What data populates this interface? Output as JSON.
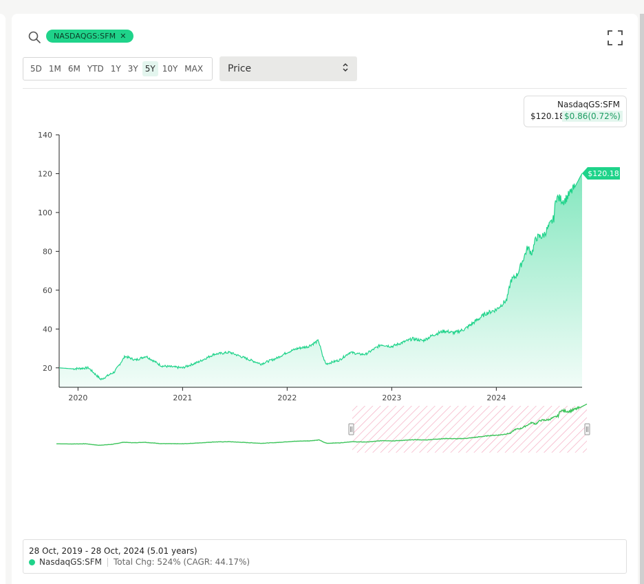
{
  "search": {
    "ticker_chip": "NASDAQGS:SFM",
    "remove_icon": "close-icon"
  },
  "icons": {
    "search": "search-icon",
    "fullscreen": "fullscreen-icon",
    "select": "chevron-updown-icon"
  },
  "ranges": [
    {
      "label": "5D",
      "active": false
    },
    {
      "label": "1M",
      "active": false
    },
    {
      "label": "6M",
      "active": false
    },
    {
      "label": "YTD",
      "active": false
    },
    {
      "label": "1Y",
      "active": false
    },
    {
      "label": "3Y",
      "active": false
    },
    {
      "label": "5Y",
      "active": true
    },
    {
      "label": "10Y",
      "active": false
    },
    {
      "label": "MAX",
      "active": false
    }
  ],
  "metric_select": {
    "value": "Price"
  },
  "legend": {
    "name": "NasdaqGS:SFM",
    "price": "$120.18",
    "change": "$0.86(0.72%)"
  },
  "colors": {
    "accent": "#1fd38a",
    "line": "#1fd38a",
    "navigator_line": "#3cc45a",
    "selection_hatch": "#f4a6bd"
  },
  "chart_data": {
    "type": "area",
    "series_name": "NasdaqGS:SFM",
    "ylim": [
      10,
      140
    ],
    "y_ticks": [
      20,
      40,
      60,
      80,
      100,
      120,
      140
    ],
    "x_range": [
      "2019-10-28",
      "2024-10-28"
    ],
    "x_tick_labels": [
      "2020",
      "2021",
      "2022",
      "2023",
      "2024"
    ],
    "last_value_label": "$120.18",
    "x": [
      2019.82,
      2019.95,
      2020.1,
      2020.22,
      2020.35,
      2020.45,
      2020.55,
      2020.65,
      2020.8,
      2021.0,
      2021.15,
      2021.3,
      2021.45,
      2021.6,
      2021.75,
      2021.9,
      2022.0,
      2022.1,
      2022.2,
      2022.3,
      2022.34,
      2022.37,
      2022.5,
      2022.6,
      2022.7,
      2022.75,
      2022.9,
      2023.0,
      2023.1,
      2023.2,
      2023.3,
      2023.4,
      2023.5,
      2023.6,
      2023.7,
      2023.8,
      2023.9,
      2024.0,
      2024.1,
      2024.14,
      2024.2,
      2024.3,
      2024.34,
      2024.38,
      2024.45,
      2024.55,
      2024.57,
      2024.65,
      2024.75,
      2024.82
    ],
    "y": [
      20,
      19.5,
      20,
      14,
      18,
      26,
      24,
      26,
      21,
      20,
      23,
      27,
      28,
      25,
      22,
      25,
      28,
      30,
      31,
      34,
      26,
      22,
      24,
      28,
      27,
      27,
      32,
      31,
      33,
      35,
      34,
      37,
      39,
      38,
      40,
      44,
      48,
      50,
      55,
      65,
      68,
      82,
      79,
      87,
      88,
      97,
      108,
      106,
      113,
      120.18
    ],
    "navigator": {
      "selected_from": "2022-08",
      "selected_to": "2024-10-28"
    }
  },
  "footer": {
    "period": "28 Oct, 2019 - 28 Oct, 2024 (5.01 years)",
    "series_name": "NasdaqGS:SFM",
    "total_change": "Total Chg: 524% (CAGR: 44.17%)"
  }
}
